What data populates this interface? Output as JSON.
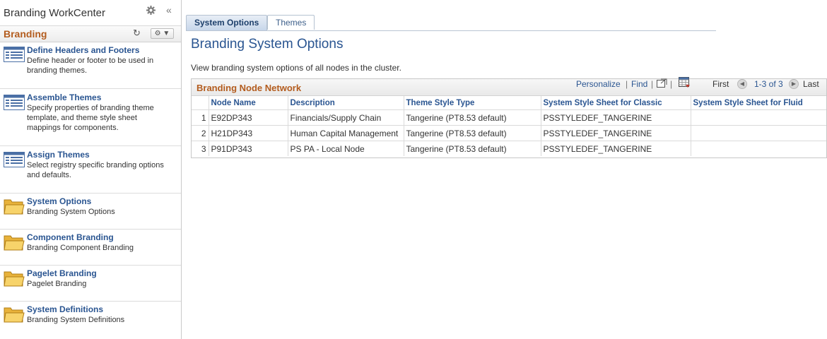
{
  "workcenter": {
    "title": "Branding WorkCenter",
    "pane_title": "Branding",
    "items": [
      {
        "title": "Define Headers and Footers",
        "desc": "Define header or footer to be used in branding themes.",
        "icon": "page-list-icon"
      },
      {
        "title": "Assemble Themes",
        "desc": "Specify properties of branding theme template, and theme style sheet mappings for components.",
        "icon": "page-list-icon"
      },
      {
        "title": "Assign Themes",
        "desc": "Select registry specific branding options and defaults.",
        "icon": "page-list-icon"
      },
      {
        "title": "System Options",
        "desc": "Branding System Options",
        "icon": "folder-icon"
      },
      {
        "title": "Component Branding",
        "desc": "Branding Component Branding",
        "icon": "folder-icon"
      },
      {
        "title": "Pagelet Branding",
        "desc": "Pagelet Branding",
        "icon": "folder-icon"
      },
      {
        "title": "System Definitions",
        "desc": "Branding System Definitions",
        "icon": "folder-icon"
      }
    ]
  },
  "tabs": [
    {
      "label": "System Options",
      "active": true
    },
    {
      "label": "Themes",
      "active": false
    }
  ],
  "page": {
    "title": "Branding System Options",
    "description": "View branding system options of all nodes in the cluster."
  },
  "grid": {
    "title": "Branding Node Network",
    "personalize": "Personalize",
    "find": "Find",
    "first": "First",
    "range": "1-3 of 3",
    "last": "Last",
    "columns": [
      "Node Name",
      "Description",
      "Theme Style Type",
      "System Style Sheet for Classic",
      "System Style Sheet for Fluid"
    ],
    "rows": [
      {
        "num": "1",
        "node": "E92DP343",
        "desc": "Financials/Supply Chain",
        "theme": "Tangerine (PT8.53 default)",
        "classic": "PSSTYLEDEF_TANGERINE",
        "fluid": ""
      },
      {
        "num": "2",
        "node": "H21DP343",
        "desc": "Human Capital Management",
        "theme": "Tangerine (PT8.53 default)",
        "classic": "PSSTYLEDEF_TANGERINE",
        "fluid": ""
      },
      {
        "num": "3",
        "node": "P91DP343",
        "desc": "PS PA - Local Node",
        "theme": "Tangerine (PT8.53 default)",
        "classic": "PSSTYLEDEF_TANGERINE",
        "fluid": ""
      }
    ]
  },
  "colors": {
    "accent_orange": "#b35c1e",
    "link_blue": "#2a5591"
  }
}
